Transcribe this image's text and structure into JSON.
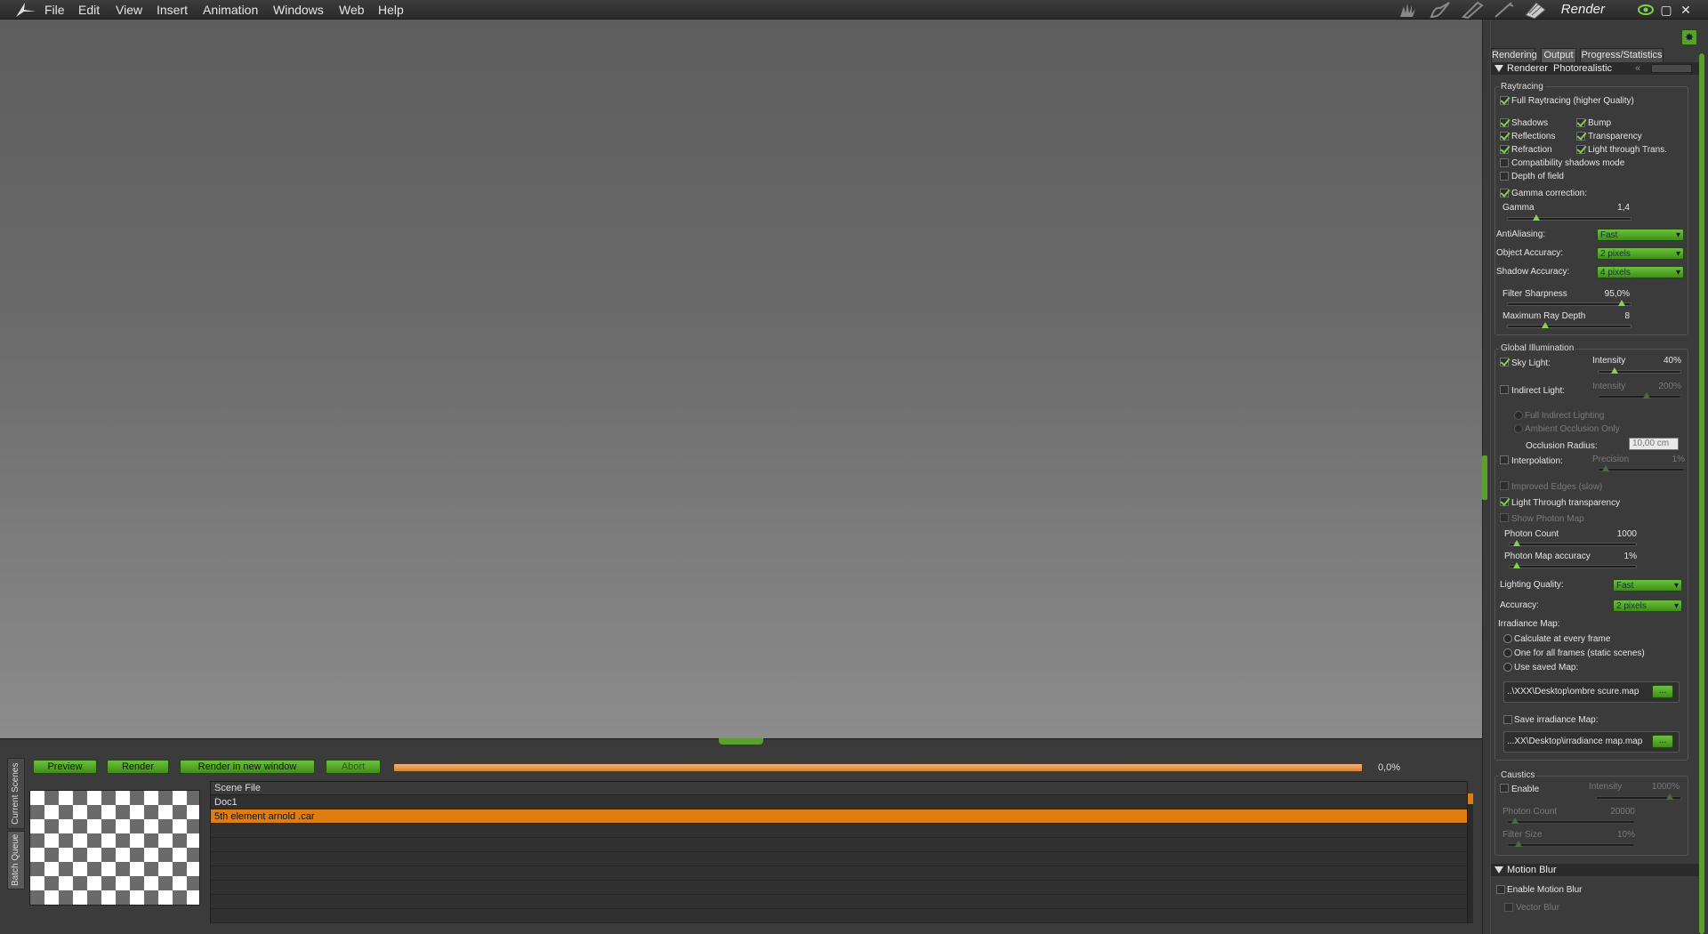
{
  "menubar": {
    "items": [
      "File",
      "Edit",
      "View",
      "Insert",
      "Animation",
      "Windows",
      "Web",
      "Help"
    ],
    "mode_label": "Render"
  },
  "colors": {
    "accent_green": "#5aa02c",
    "selection_orange": "#e07d10",
    "progress_orange": "#e08a35"
  },
  "batch": {
    "side_tabs": [
      "Current Scenes",
      "Batch Queue"
    ],
    "buttons": {
      "preview": "Preview",
      "render": "Render",
      "render_new_window": "Render in new window",
      "abort": "Abort"
    },
    "progress": {
      "text": "0,0%",
      "value": 0.0
    },
    "table": {
      "header": "Scene File",
      "rows": [
        "Doc1",
        "5th element arnold .car"
      ],
      "selected_index": 1
    }
  },
  "render_panel": {
    "tabs": [
      "Rendering",
      "Output",
      "Progress/Statistics"
    ],
    "renderer": {
      "label": "Renderer",
      "value": "Photorealistic"
    },
    "raytracing": {
      "title": "Raytracing",
      "full_raytracing": {
        "label": "Full Raytracing (higher Quality)",
        "checked": true
      },
      "shadows": {
        "label": "Shadows",
        "checked": true
      },
      "bump": {
        "label": "Bump",
        "checked": true
      },
      "reflections": {
        "label": "Reflections",
        "checked": true
      },
      "transparency": {
        "label": "Transparency",
        "checked": true
      },
      "refraction": {
        "label": "Refraction",
        "checked": true
      },
      "light_through_trans": {
        "label": "Light through Trans.",
        "checked": true
      },
      "compat_shadows": {
        "label": "Compatibility shadows mode",
        "checked": false
      },
      "dof": {
        "label": "Depth of field",
        "checked": false
      },
      "gamma_correction": {
        "label": "Gamma correction:",
        "checked": true
      },
      "gamma": {
        "label": "Gamma",
        "value": "1,4"
      },
      "antialiasing": {
        "label": "AntiAliasing:",
        "value": "Fast"
      },
      "object_accuracy": {
        "label": "Object Accuracy:",
        "value": "2 pixels"
      },
      "shadow_accuracy": {
        "label": "Shadow Accuracy:",
        "value": "4 pixels"
      },
      "filter_sharpness": {
        "label": "Filter Sharpness",
        "value": "95,0%"
      },
      "max_ray_depth": {
        "label": "Maximum Ray Depth",
        "value": "8"
      }
    },
    "gi": {
      "title": "Global Illumination",
      "sky_light": {
        "label": "Sky Light:",
        "checked": true,
        "intensity_label": "Intensity",
        "intensity": "40%"
      },
      "indirect_light": {
        "label": "Indirect Light:",
        "checked": false,
        "intensity_label": "Intensity",
        "intensity": "200%"
      },
      "full_indirect": "Full Indirect Lighting",
      "ambient_occlusion": "Ambient Occlusion Only",
      "occlusion_radius": {
        "label": "Occlusion Radius:",
        "value": "10,00 cm"
      },
      "interpolation": {
        "label": "Interpolation:",
        "precision_label": "Precision",
        "precision": "1%"
      },
      "improved_edges": "Improved Edges (slow)",
      "light_through_transparency": {
        "label": "Light Through transparency",
        "checked": true
      },
      "show_photon_map": "Show Photon Map",
      "photon_count": {
        "label": "Photon Count",
        "value": "1000"
      },
      "photon_map_accuracy": {
        "label": "Photon Map accuracy",
        "value": "1%"
      },
      "lighting_quality": {
        "label": "Lighting Quality:",
        "value": "Fast"
      },
      "accuracy": {
        "label": "Accuracy:",
        "value": "2 pixels"
      },
      "irradiance_map": {
        "label": "Irradiance Map:",
        "options": [
          "Calculate at every frame",
          "One for all frames (static scenes)",
          "Use saved Map:"
        ],
        "saved_path": "..\\XXX\\Desktop\\ombre scure.map",
        "save_label": "Save irradiance Map:",
        "save_path": "...XX\\Desktop\\irradiance map.map",
        "browse": "..."
      }
    },
    "caustics": {
      "title": "Caustics",
      "enable": "Enable",
      "intensity_label": "Intensity",
      "intensity": "1000%",
      "photon_count_label": "Photon Count",
      "photon_count": "20000",
      "filter_size_label": "Filter Size",
      "filter_size": "10%"
    },
    "motion_blur": {
      "title": "Motion Blur",
      "enable": "Enable Motion Blur",
      "vector": "Vector Blur"
    }
  }
}
